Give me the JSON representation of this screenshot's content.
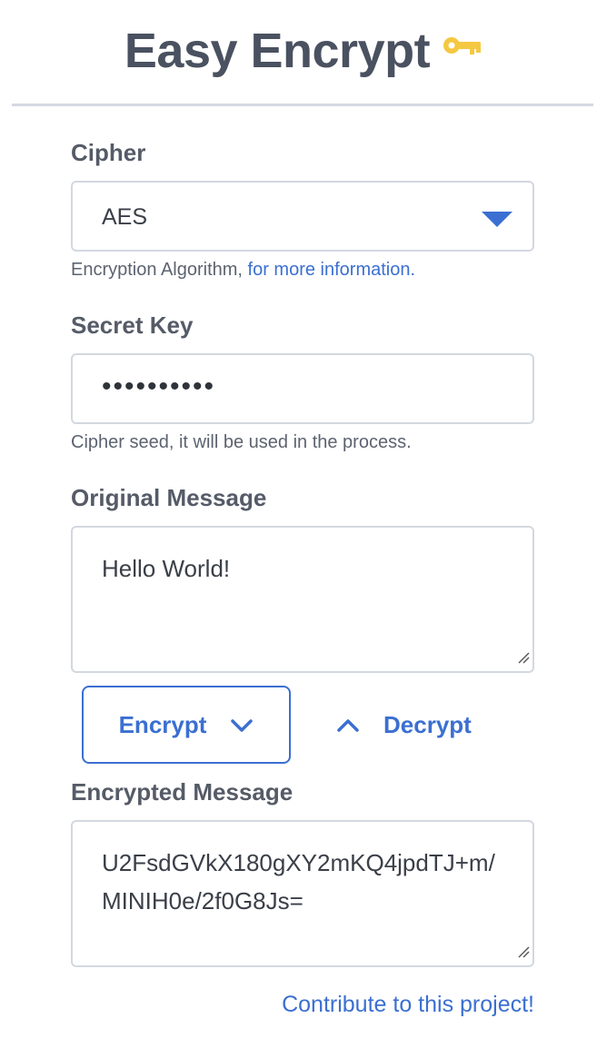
{
  "header": {
    "title": "Easy Encrypt",
    "icon": "key-icon",
    "icon_color": "#f5c842"
  },
  "cipher": {
    "label": "Cipher",
    "selected": "AES",
    "hint_prefix": "Encryption Algorithm, ",
    "hint_link": "for more information."
  },
  "secret_key": {
    "label": "Secret Key",
    "masked_value": "••••••••••",
    "hint": "Cipher seed, it will be used in the process."
  },
  "original_message": {
    "label": "Original Message",
    "value": "Hello World!"
  },
  "actions": {
    "encrypt_label": "Encrypt",
    "decrypt_label": "Decrypt"
  },
  "encrypted_message": {
    "label": "Encrypted Message",
    "value": "U2FsdGVkX180gXY2mKQ4jpdTJ+m/MINIH0e/2f0G8Js="
  },
  "footer": {
    "contribute_link": "Contribute to this project!"
  },
  "colors": {
    "accent": "#3b6fd1",
    "text": "#4a5160",
    "border": "#d3d8df"
  }
}
